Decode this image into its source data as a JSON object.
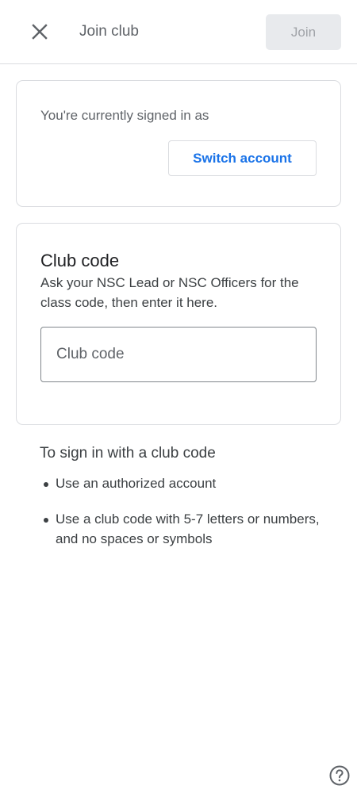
{
  "header": {
    "title": "Join club",
    "join_label": "Join"
  },
  "account": {
    "signed_in_text": "You're currently signed in as",
    "switch_label": "Switch account"
  },
  "club_code": {
    "title": "Club code",
    "description": "Ask your NSC Lead or NSC Officers for the class code, then enter it here.",
    "input_placeholder": "Club code",
    "input_value": ""
  },
  "tips": {
    "title": "To sign in with a club code",
    "items": [
      "Use an authorized account",
      "Use a club code with 5-7 letters or numbers, and no spaces or symbols"
    ]
  },
  "icons": {
    "close": "close-icon",
    "help": "help-icon"
  },
  "colors": {
    "accent": "#1a73e8",
    "border": "#dadce0",
    "disabled_bg": "#e8eaed",
    "disabled_text": "#a0a3a8"
  }
}
